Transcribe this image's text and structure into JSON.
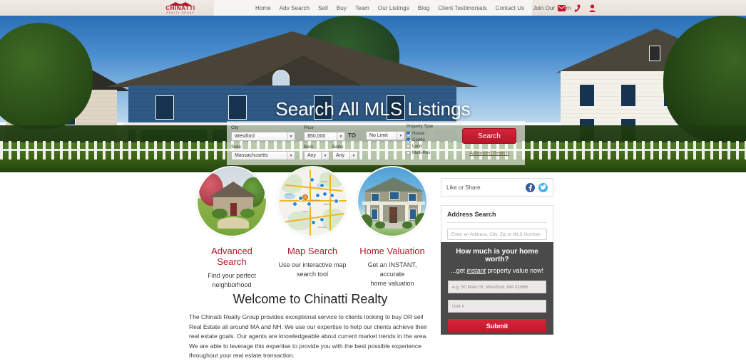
{
  "brand": {
    "logo_name": "CHINATTI",
    "logo_sub": "REALTY GROUP",
    "accent_red": "#a6192e",
    "button_red": "#c8102e"
  },
  "header": {
    "nav": [
      {
        "label": "Home"
      },
      {
        "label": "Adv Search"
      },
      {
        "label": "Sell"
      },
      {
        "label": "Buy"
      },
      {
        "label": "Team"
      },
      {
        "label": "Our Listings"
      },
      {
        "label": "Blog"
      },
      {
        "label": "Client Testimonials"
      },
      {
        "label": "Contact Us"
      },
      {
        "label": "Join Our Team"
      }
    ],
    "icons": [
      "envelope-icon",
      "phone-icon",
      "user-icon"
    ]
  },
  "hero": {
    "title": "Search All MLS Listings"
  },
  "search_form": {
    "city_label": "City",
    "city_value": "Westford",
    "state_label": "State",
    "state_value": "Massachusetts",
    "price_label": "Price",
    "price_value": "$50,000",
    "to_label": "TO",
    "price_max_value": "No Limit",
    "beds_label": "Beds",
    "beds_value": "Any",
    "baths_label": "Baths",
    "baths_value": "Any",
    "property_type_label": "Property Type",
    "property_types": [
      {
        "label": "House",
        "checked": true
      },
      {
        "label": "Condo",
        "checked": true
      },
      {
        "label": "Land",
        "checked": false
      },
      {
        "label": "Multi-Res",
        "checked": false
      }
    ],
    "search_button": "Search",
    "advanced_search_link": "Advanced Search"
  },
  "features": [
    {
      "title": "Advanced Search",
      "desc_line1": "Find your perfect",
      "desc_line2": "neighborhood",
      "image": "house-photo"
    },
    {
      "title": "Map Search",
      "desc_line1": "Use our interactive map",
      "desc_line2": "search tool",
      "image": "map-thumbnail"
    },
    {
      "title": "Home Valuation",
      "desc_line1": "Get an INSTANT, accurate",
      "desc_line2": "home valuation",
      "image": "colonial-house-photo"
    }
  ],
  "sidebar": {
    "like_or_share": "Like or Share",
    "facebook_icon": "facebook-icon",
    "twitter_icon": "twitter-icon",
    "address_search_title": "Address Search",
    "address_search_placeholder": "Enter an Address, City, Zip or MLS Number"
  },
  "home_value": {
    "title": "How much is your home worth?",
    "sub_prefix": "...get ",
    "sub_italic": "instant",
    "sub_suffix": " property value now!",
    "address_placeholder": "e.g. 50 Main St, Westford, MA 01886",
    "unit_placeholder": "Unit #",
    "submit_label": "Submit"
  },
  "welcome": {
    "heading": "Welcome to Chinatti Realty",
    "body": "The Chinatti Realty Group provides exceptional service to clients looking to buy OR sell Real Estate all around MA and NH. We use our expertise to help our clients achieve their real estate goals. Our agents are knowledgeable about current market trends in the area. We are able to leverage this expertise to provide you with the best possible experience throughout your real estate transaction."
  }
}
